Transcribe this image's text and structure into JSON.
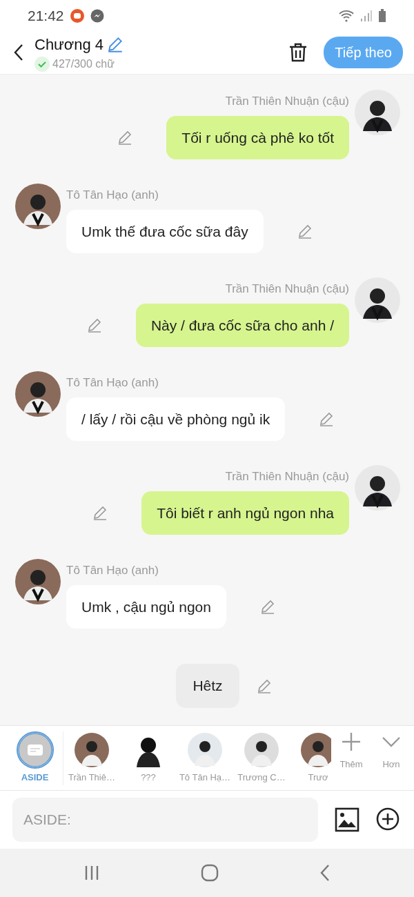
{
  "status_bar": {
    "time": "21:42"
  },
  "header": {
    "title": "Chương 4",
    "word_count": "427/300 chữ",
    "next_button": "Tiếp theo"
  },
  "messages": [
    {
      "kind": "right",
      "speaker": "Trần Thiên Nhuận (cậu)",
      "text": "Tối r uống cà phê ko tốt"
    },
    {
      "kind": "left",
      "speaker": "Tô Tân Hạo (anh)",
      "text": "Umk thế đưa cốc sữa đây"
    },
    {
      "kind": "right",
      "speaker": "Trần Thiên Nhuận (cậu)",
      "text": "Này / đưa cốc sữa cho anh /"
    },
    {
      "kind": "left",
      "speaker": "Tô Tân Hạo (anh)",
      "text": "/ lấy / rồi cậu về phòng ngủ ik"
    },
    {
      "kind": "right",
      "speaker": "Trần Thiên Nhuận (cậu)",
      "text": "Tôi biết r anh ngủ ngon nha"
    },
    {
      "kind": "left",
      "speaker": "Tô Tân Hạo (anh)",
      "text": "Umk , cậu ngủ ngon"
    },
    {
      "kind": "aside",
      "text": "Hêtz"
    }
  ],
  "characters": [
    {
      "kind": "aside",
      "label": "ASIDE",
      "selected": true
    },
    {
      "label": "Trần Thiê…",
      "selected": false
    },
    {
      "kind": "silhouette",
      "label": "???",
      "selected": false
    },
    {
      "label": "Tô Tân Hạ…",
      "selected": false
    },
    {
      "label": "Trương C…",
      "selected": false
    },
    {
      "label": "Trươ",
      "selected": false
    }
  ],
  "strip_actions": [
    {
      "kind": "add",
      "label": "Thêm"
    },
    {
      "kind": "more",
      "label": "Hơn"
    }
  ],
  "composer": {
    "placeholder": "ASIDE:"
  }
}
